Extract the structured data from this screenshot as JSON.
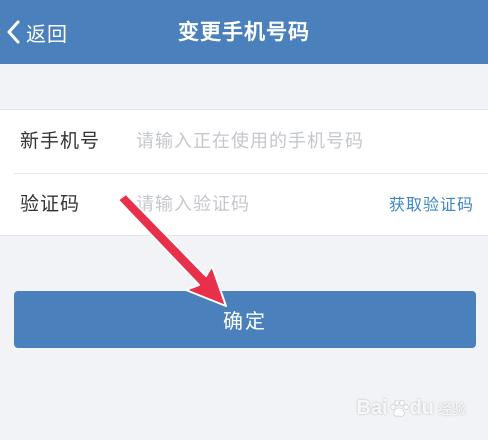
{
  "header": {
    "back_label": "返回",
    "title": "变更手机号码"
  },
  "form": {
    "phone": {
      "label": "新手机号",
      "placeholder": "请输入正在使用的手机号码"
    },
    "code": {
      "label": "验证码",
      "placeholder": "请输入验证码",
      "action_label": "获取验证码"
    }
  },
  "confirm_label": "确定",
  "watermark": {
    "brand_left": "Bai",
    "brand_right": "du",
    "text": "经验"
  },
  "colors": {
    "primary": "#4a80bb",
    "link": "#3d86c6",
    "annotation_arrow": "#e8304a",
    "background": "#f1f3f6"
  },
  "icons": {
    "back": "chevron-left-icon",
    "annotation": "red-arrow-pointer-icon",
    "watermark": "baidu-paw-icon"
  }
}
